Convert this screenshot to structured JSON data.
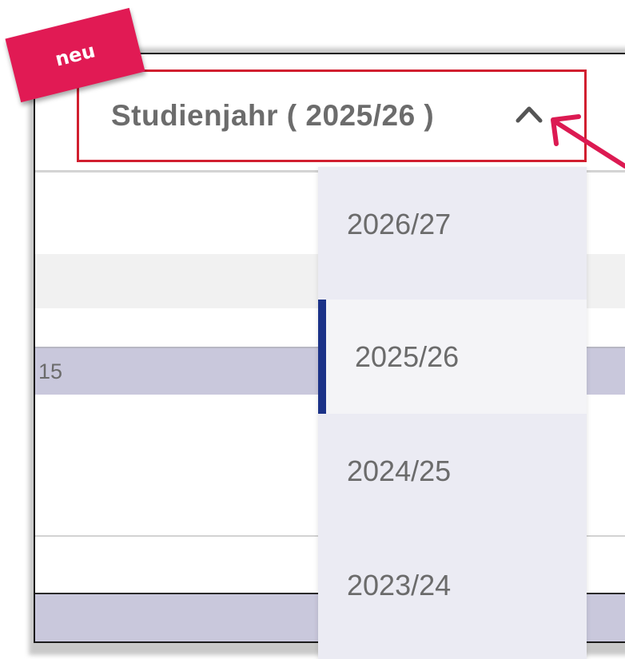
{
  "badge": {
    "label": "neu"
  },
  "selector": {
    "label": "Studienjahr ( 2025/26 )",
    "chevron_icon": "chevron-up-icon",
    "expanded": true
  },
  "table": {
    "visible_cell": "15"
  },
  "dropdown": {
    "options": [
      {
        "label": "2026/27",
        "selected": false
      },
      {
        "label": "2025/26",
        "selected": true
      },
      {
        "label": "2024/25",
        "selected": false
      },
      {
        "label": "2023/24",
        "selected": false
      }
    ]
  },
  "colors": {
    "highlight_border": "#d11f2f",
    "badge": "#e11a54",
    "arrow": "#dc1a52",
    "selected_marker": "#1b3288",
    "dropdown_bg": "#ebebf3"
  }
}
